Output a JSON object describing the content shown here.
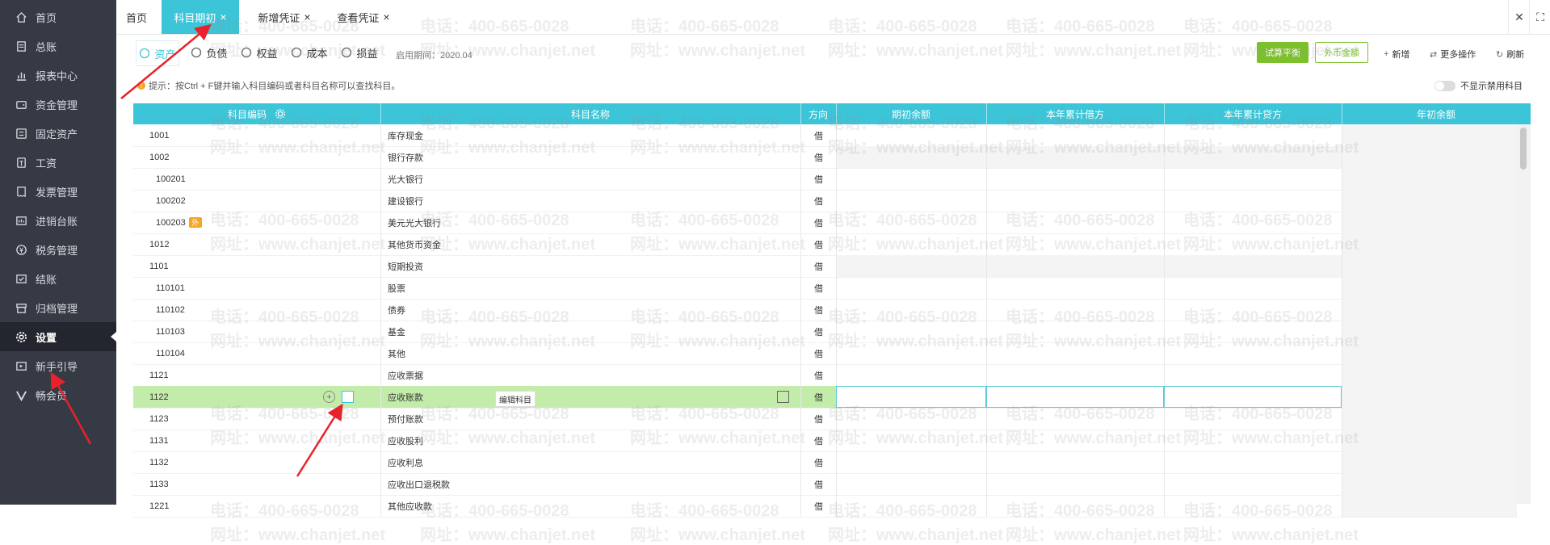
{
  "sidebar": {
    "items": [
      {
        "label": "首页",
        "icon": "home-icon"
      },
      {
        "label": "总账",
        "icon": "ledger-icon"
      },
      {
        "label": "报表中心",
        "icon": "chart-icon"
      },
      {
        "label": "资金管理",
        "icon": "wallet-icon"
      },
      {
        "label": "固定资产",
        "icon": "asset-icon"
      },
      {
        "label": "工资",
        "icon": "salary-icon"
      },
      {
        "label": "发票管理",
        "icon": "invoice-icon"
      },
      {
        "label": "进销台账",
        "icon": "inventory-icon"
      },
      {
        "label": "税务管理",
        "icon": "tax-icon"
      },
      {
        "label": "结账",
        "icon": "checkout-icon"
      },
      {
        "label": "归档管理",
        "icon": "archive-icon"
      },
      {
        "label": "设置",
        "icon": "gear-icon",
        "active": true
      },
      {
        "label": "新手引导",
        "icon": "guide-icon"
      },
      {
        "label": "畅会员",
        "icon": "vip-icon"
      }
    ]
  },
  "tabs": [
    {
      "label": "首页",
      "closable": false,
      "active": false
    },
    {
      "label": "科目期初",
      "closable": true,
      "active": true
    },
    {
      "label": "新增凭证",
      "closable": true,
      "active": false
    },
    {
      "label": "查看凭证",
      "closable": true,
      "active": false
    }
  ],
  "tab_close_glyph": "×",
  "window_close": "✕",
  "window_max": "⛶",
  "category_tabs": [
    {
      "label": "资产",
      "active": true
    },
    {
      "label": "负债",
      "active": false
    },
    {
      "label": "权益",
      "active": false
    },
    {
      "label": "成本",
      "active": false
    },
    {
      "label": "损益",
      "active": false
    }
  ],
  "period_text": "启用期间：2020.04",
  "toolbar": {
    "trial_balance": "试算平衡",
    "foreign_amount": "外币金额",
    "add": "新增",
    "more": "更多操作",
    "refresh": "刷新"
  },
  "tip_text": "提示：按Ctrl + F键并输入科目编码或者科目名称可以查找科目。",
  "toggle_label": "不显示禁用科目",
  "columns": {
    "code": "科目编码",
    "name": "科目名称",
    "direction": "方向",
    "opening": "期初余额",
    "ytd_debit": "本年累计借方",
    "ytd_credit": "本年累计贷方",
    "year_start": "年初余额"
  },
  "rows": [
    {
      "code": "1001",
      "name": "库存现金",
      "dir": "借",
      "sub": false,
      "fill": false
    },
    {
      "code": "1002",
      "name": "银行存款",
      "dir": "借",
      "sub": false,
      "fill": true
    },
    {
      "code": "100201",
      "name": "光大银行",
      "dir": "借",
      "sub": true,
      "fill": false
    },
    {
      "code": "100202",
      "name": "建设银行",
      "dir": "借",
      "sub": true,
      "fill": false
    },
    {
      "code": "100203",
      "name": "美元光大银行",
      "dir": "借",
      "sub": true,
      "fill": false,
      "badge": "外"
    },
    {
      "code": "1012",
      "name": "其他货币资金",
      "dir": "借",
      "sub": false,
      "fill": false
    },
    {
      "code": "1101",
      "name": "短期投资",
      "dir": "借",
      "sub": false,
      "fill": true
    },
    {
      "code": "110101",
      "name": "股票",
      "dir": "借",
      "sub": true,
      "fill": false
    },
    {
      "code": "110102",
      "name": "债券",
      "dir": "借",
      "sub": true,
      "fill": false
    },
    {
      "code": "110103",
      "name": "基金",
      "dir": "借",
      "sub": true,
      "fill": false
    },
    {
      "code": "110104",
      "name": "其他",
      "dir": "借",
      "sub": true,
      "fill": false
    },
    {
      "code": "1121",
      "name": "应收票据",
      "dir": "借",
      "sub": false,
      "fill": false
    },
    {
      "code": "1122",
      "name": "应收账款",
      "dir": "借",
      "sub": false,
      "fill": false,
      "highlight": true
    },
    {
      "code": "1123",
      "name": "预付账款",
      "dir": "借",
      "sub": false,
      "fill": false
    },
    {
      "code": "1131",
      "name": "应收股利",
      "dir": "借",
      "sub": false,
      "fill": false
    },
    {
      "code": "1132",
      "name": "应收利息",
      "dir": "借",
      "sub": false,
      "fill": false
    },
    {
      "code": "1133",
      "name": "应收出口退税款",
      "dir": "借",
      "sub": false,
      "fill": false
    },
    {
      "code": "1221",
      "name": "其他应收款",
      "dir": "借",
      "sub": false,
      "fill": false
    }
  ],
  "tooltip_edit": "编辑科目",
  "watermark": {
    "phone": "电话：400-665-0028",
    "site": "网址：www.chanjet.net"
  },
  "colors": {
    "accent": "#3cc5d8",
    "sidebar": "#363a44",
    "green": "#7cc12c",
    "highlight_row": "#c3ecaa",
    "arrow": "#e8222a"
  }
}
